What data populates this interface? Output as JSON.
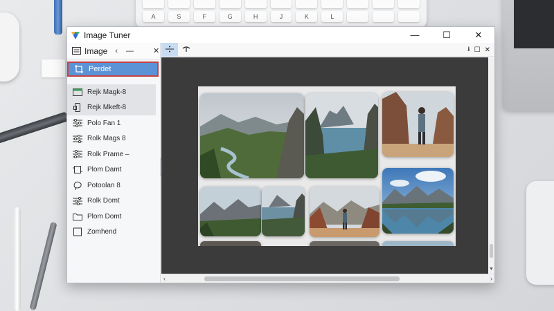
{
  "app": {
    "title": "Image Tuner"
  },
  "window_controls": {
    "minimize": "—",
    "maximize": "☐",
    "close": "✕"
  },
  "panel": {
    "title": "Image",
    "less_symbol": "‹",
    "minimize_symbol": "—",
    "close_symbol": "✕",
    "items": [
      {
        "label": "Perdet",
        "icon": "crop-icon",
        "state": "selected"
      },
      {
        "label": "Rejk Magk-8",
        "icon": "calendar-icon",
        "state": "shaded"
      },
      {
        "label": "Rejk Mkeft-8",
        "icon": "phone-icon",
        "state": "shaded"
      },
      {
        "label": "Polo Fan 1",
        "icon": "sliders-icon",
        "state": "normal"
      },
      {
        "label": "Rolk Mags 8",
        "icon": "sliders-icon",
        "state": "normal"
      },
      {
        "label": "Rolk Prame –",
        "icon": "sliders-icon",
        "state": "normal"
      },
      {
        "label": "Plom Damt",
        "icon": "frame-icon",
        "state": "normal"
      },
      {
        "label": "Potoolan 8",
        "icon": "lasso-icon",
        "state": "normal"
      },
      {
        "label": "Rolk Domt",
        "icon": "sliders-icon",
        "state": "normal"
      },
      {
        "label": "Plom Domt",
        "icon": "folder-icon",
        "state": "normal"
      },
      {
        "label": "Zomhend",
        "icon": "square-icon",
        "state": "normal"
      }
    ]
  },
  "toolbar": {
    "tools": [
      {
        "name": "split-tool",
        "active": true
      },
      {
        "name": "arch-tool",
        "active": false
      }
    ],
    "right_symbols": {
      "download": "⭳",
      "restore": "☐",
      "close": "✕"
    }
  },
  "canvas": {
    "photos": [
      {
        "scene": "mountain valley with river"
      },
      {
        "scene": "lake between rock peaks"
      },
      {
        "scene": "person standing on rock"
      },
      {
        "scene": "mountain peaks with forest"
      },
      {
        "scene": "rocky cliff by lake"
      },
      {
        "scene": "hiker on red rock plateau"
      },
      {
        "scene": "mountains reflected in lake"
      }
    ]
  },
  "colors": {
    "accent": "#5b93d6",
    "selection_border": "#c64244",
    "canvas_bg": "#3b3b3b",
    "active_tool": "#c7dbf1"
  },
  "keyboard_keys": [
    "A",
    "S",
    "F",
    "G",
    "H",
    "J",
    "K",
    "L"
  ]
}
